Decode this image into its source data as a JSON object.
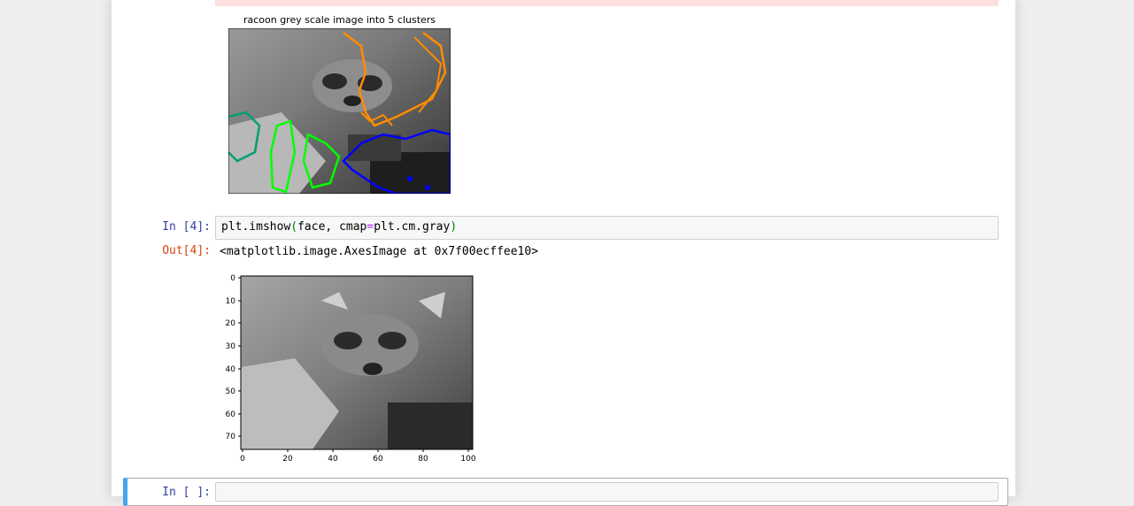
{
  "figure1": {
    "title": "racoon grey scale image into 5 clusters",
    "contour_colors": [
      "#ff8c00",
      "#0000ff",
      "#00ff00",
      "#009e73"
    ]
  },
  "cell4": {
    "in_prompt": "In [4]:",
    "code": {
      "part1": "plt.imshow",
      "paren_open": "(",
      "part2": "face, cmap",
      "op": "=",
      "part3": "plt.cm.gray",
      "paren_close": ")"
    },
    "out_prompt": "Out[4]:",
    "output_text": "<matplotlib.image.AxesImage at 0x7f00ecffee10>"
  },
  "figure2": {
    "y_ticks": [
      "0",
      "10",
      "20",
      "30",
      "40",
      "50",
      "60",
      "70"
    ],
    "x_ticks": [
      "0",
      "20",
      "40",
      "60",
      "80",
      "100"
    ]
  },
  "next_cell": {
    "in_prompt": "In [ ]:"
  }
}
